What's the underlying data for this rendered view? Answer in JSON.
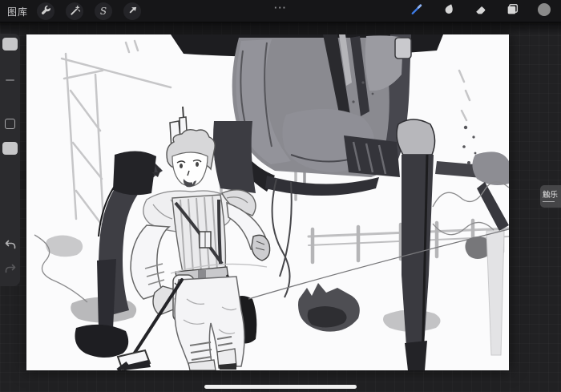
{
  "topbar": {
    "gallery_label": "图库",
    "menu_dots": "···",
    "selection_glyph": "S",
    "left_tools": [
      "actions",
      "adjustments",
      "selection",
      "transform"
    ],
    "right_tools": [
      "paint",
      "smudge",
      "erase",
      "layers",
      "color"
    ],
    "active_tool": "paint",
    "accent_color": "#3D7CE8",
    "current_color": "#8A8A8A"
  },
  "sidebar": {
    "controls": [
      "brush-size-slider",
      "modify-button",
      "opacity-slider",
      "undo",
      "redo"
    ]
  },
  "watermark": {
    "label": "触乐"
  },
  "canvas": {
    "background": "#FBFBFC",
    "content": "sketch of a walking character in front of a large four-legged mech"
  }
}
